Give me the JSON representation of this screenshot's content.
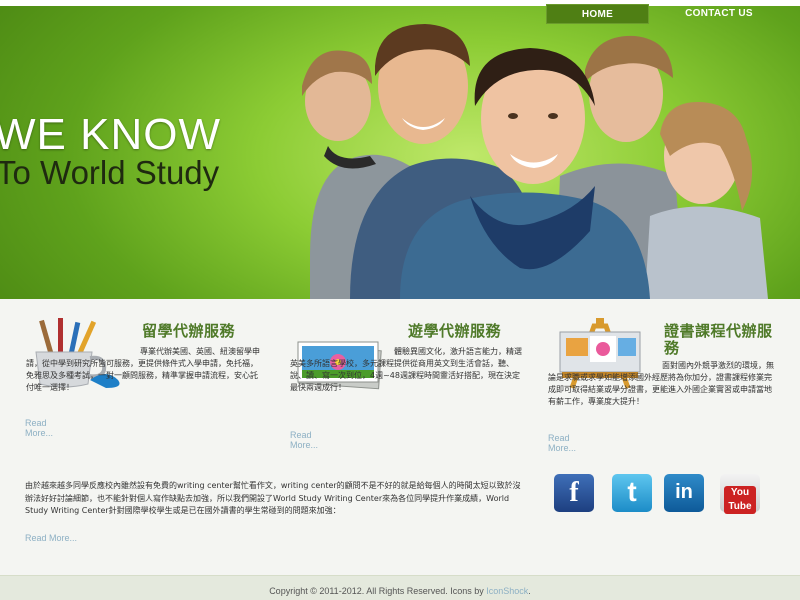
{
  "nav": {
    "items": [
      {
        "label": "HOME",
        "active": true
      },
      {
        "label": "CONTACT US",
        "active": false
      }
    ]
  },
  "hero": {
    "headline": "WE KNOW",
    "subheadline": "To World Study"
  },
  "services": [
    {
      "title": "留學代辦服務",
      "icon": "paint-brushes-icon",
      "text": "專業代辦美國、英國、紐澳留學申請，從中學到研究所皆可服務，更提供條件式入學申請，免托福，免雅思及多種考試，一對一顧問服務，精準掌握申請流程，安心託付唯一選擇！",
      "more": "Read More..."
    },
    {
      "title": "遊學代辦服務",
      "icon": "photo-frames-icon",
      "text": "體驗異國文化，激升語言能力，精選英美多所語言學校，多元課程提供從商用英文到生活會話，聽、說、讀、寫一次到位，4週~48週課程時間靈活好搭配，現在決定最快兩週成行！",
      "more": "Read More..."
    },
    {
      "title": "證書課程代辦服務",
      "icon": "easel-painting-icon",
      "text": "面對國內外競爭激烈的環境，無論是求職或求學如能增添國外經歷將為你加分，證書課程修業完成即可取得結業或學分證書，更能進入外國企業實習或申請當地有薪工作，專業度大提升！",
      "more": "Read More..."
    }
  ],
  "bottom": {
    "text": "由於越來越多同學反應校內雖然設有免費的writing center幫忙看作文，writing center的顧問不是不好的就是給每個人的時間太短以致於沒辦法好好討論細節，也不能針對個人寫作缺點去加強，所以我們開設了World Study Writing Center來為各位同學提升作業成績，World Study Writing Center針對國際學校學生或是已在國外讀書的學生常碰到的問題來加強：",
    "more": "Read More..."
  },
  "social": [
    {
      "name": "facebook-icon",
      "glyph": "f",
      "color": "#2c5aa0"
    },
    {
      "name": "twitter-icon",
      "glyph": "t",
      "color": "#34aee3"
    },
    {
      "name": "linkedin-icon",
      "glyph": "in",
      "color": "#1f74b3"
    },
    {
      "name": "youtube-icon",
      "glyph": "You Tube",
      "color": "#cc2222"
    }
  ],
  "footer": {
    "copyright": "Copyright © 2011-2012. All Rights Reserved. Icons by ",
    "credit": "IconShock",
    "end": "."
  }
}
